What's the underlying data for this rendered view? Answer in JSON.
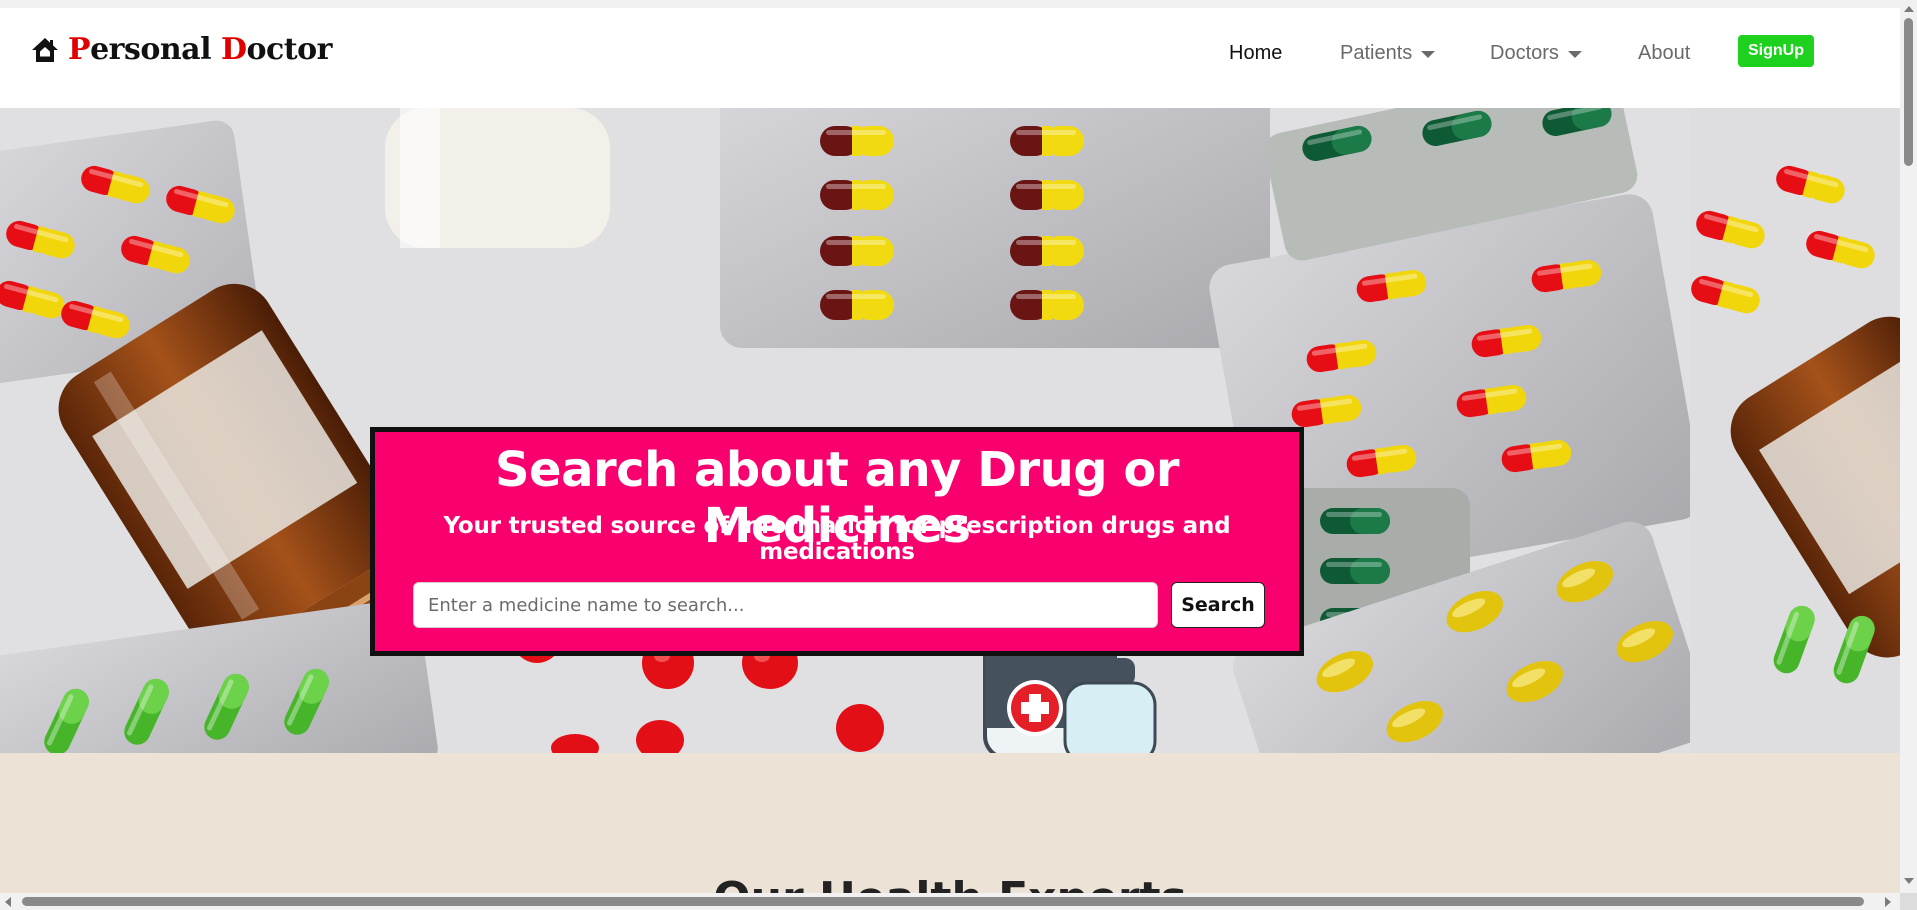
{
  "brand": {
    "icon": "home-icon",
    "letter1": "P",
    "word1_rest": "ersonal ",
    "letter2": "D",
    "word2_rest": "octor",
    "accent_color": "#e00000"
  },
  "nav": {
    "home": "Home",
    "patients": "Patients",
    "doctors": "Doctors",
    "about": "About",
    "signup": "SignUp",
    "signup_color": "#1ed11e"
  },
  "hero": {
    "title": "Search about any Drug or Medicines",
    "subtitle": "Your trusted source of information for prescription drugs and medications",
    "search_placeholder": "Enter a medicine name to search...",
    "search_button": "Search",
    "box_color": "#f8006e"
  },
  "section": {
    "heading": "Our Health Experts"
  }
}
